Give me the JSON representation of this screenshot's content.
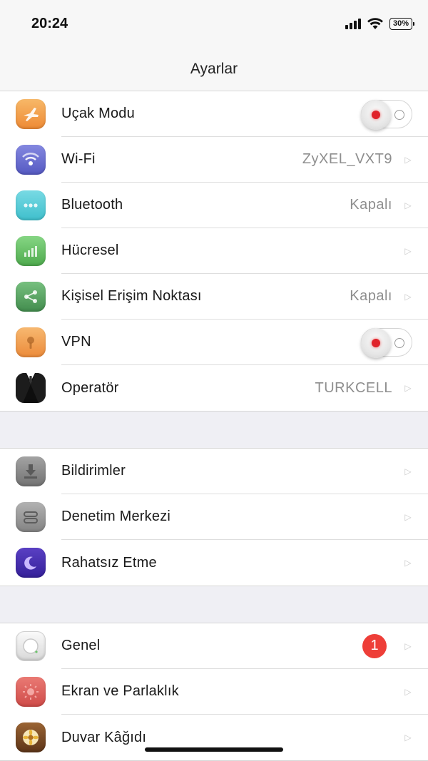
{
  "status": {
    "time": "20:24",
    "battery": "30%"
  },
  "nav": {
    "title": "Ayarlar"
  },
  "groups": [
    [
      {
        "label": "Uçak Modu",
        "icon": "airplane-icon",
        "control": "toggle"
      },
      {
        "label": "Wi-Fi",
        "icon": "wifi-icon",
        "value": "ZyXEL_VXT9"
      },
      {
        "label": "Bluetooth",
        "icon": "bluetooth-icon",
        "value": "Kapalı"
      },
      {
        "label": "Hücresel",
        "icon": "cellular-icon"
      },
      {
        "label": "Kişisel Erişim Noktası",
        "icon": "hotspot-icon",
        "value": "Kapalı"
      },
      {
        "label": "VPN",
        "icon": "vpn-icon",
        "control": "toggle"
      },
      {
        "label": "Operatör",
        "icon": "carrier-icon",
        "value": "TURKCELL"
      }
    ],
    [
      {
        "label": "Bildirimler",
        "icon": "notifications-icon"
      },
      {
        "label": "Denetim Merkezi",
        "icon": "control-center-icon"
      },
      {
        "label": "Rahatsız Etme",
        "icon": "do-not-disturb-icon"
      }
    ],
    [
      {
        "label": "Genel",
        "icon": "general-icon",
        "badge": "1"
      },
      {
        "label": "Ekran ve Parlaklık",
        "icon": "display-brightness-icon"
      },
      {
        "label": "Duvar Kâğıdı",
        "icon": "wallpaper-icon"
      }
    ]
  ],
  "colors": {
    "airplane": "#f4a04e",
    "wifi": "#6b6fd0",
    "bluetooth": "#5fcdd8",
    "cellular": "#6cc46a",
    "hotspot": "#5aa866",
    "vpn": "#f2a356",
    "carrier": "#111111",
    "notifications": "#8a8a8a",
    "control_center": "#9a9a9a",
    "dnd": "#4a2fae",
    "general": "#e8e8e8",
    "display": "#e06060",
    "wallpaper": "#7a4a28",
    "toggle_dot": "#e0222a",
    "badge": "#ee3e38"
  }
}
